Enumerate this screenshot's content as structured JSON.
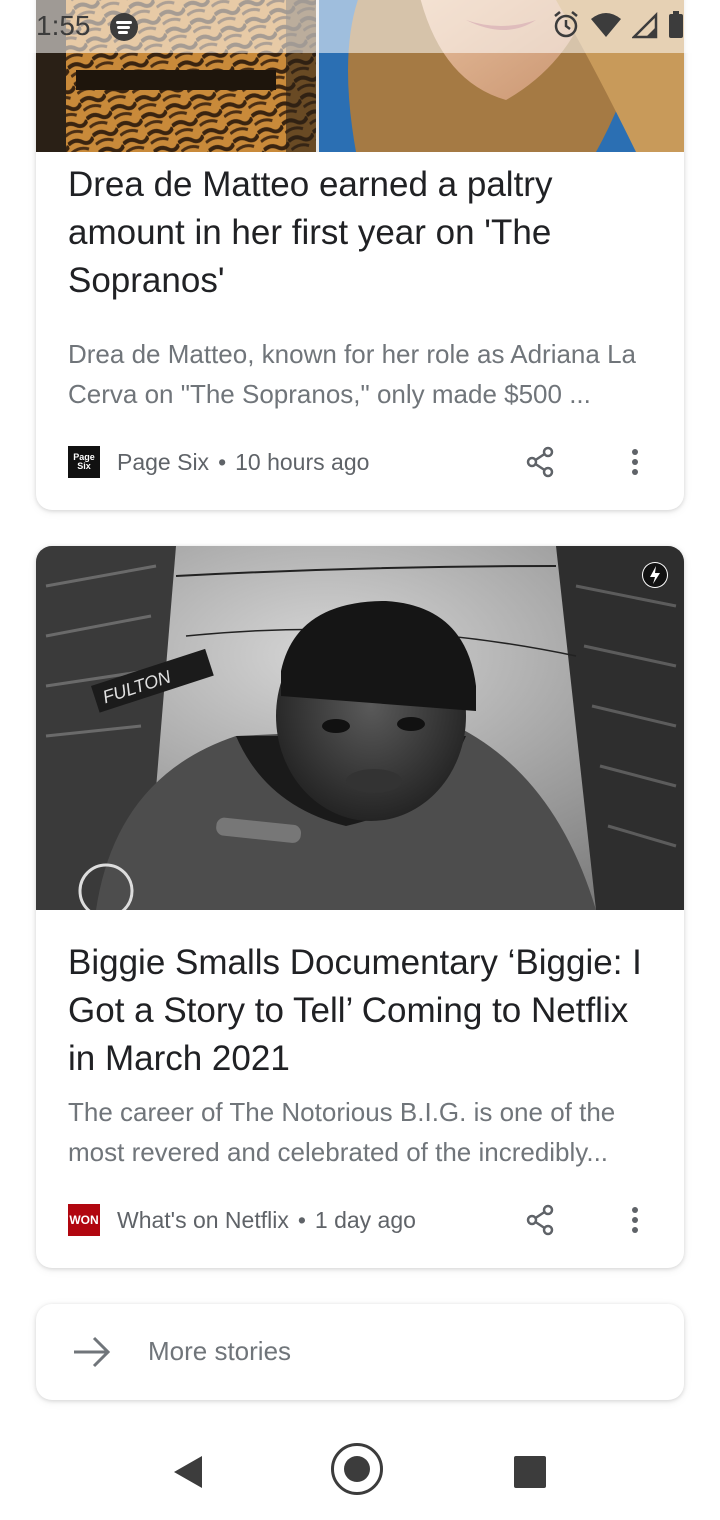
{
  "status_bar": {
    "time": "1:55",
    "icons": [
      "spotify-icon",
      "alarm-icon",
      "wifi-icon",
      "signal-icon",
      "battery-icon"
    ]
  },
  "stories": [
    {
      "headline": "Drea de Matteo earned a paltry amount in her first year on 'The Sopranos'",
      "snippet": "Drea de Matteo, known for her role as Adriana La Cerva on \"The Sopranos,\" only made $500 ...",
      "source": "Page Six",
      "source_logo": "Page Six",
      "time": "10 hours ago",
      "separator": "•",
      "logo_color": "#111111"
    },
    {
      "headline": "Biggie Smalls Documentary ‘Biggie: I Got a Story to Tell’ Coming to Netflix in March 2021",
      "snippet": "The career of The Notorious B.I.G. is one of the most revered and celebrated of the incredibly...",
      "source": "What's on Netflix",
      "source_logo": "WON",
      "time": "1 day ago",
      "separator": "•",
      "logo_color": "#b1060f",
      "image_sign_text": "FULTON"
    }
  ],
  "more_stories": {
    "label": "More stories"
  },
  "colors": {
    "text": "#202124",
    "secondary": "#70757a",
    "meta": "#5f6368"
  }
}
